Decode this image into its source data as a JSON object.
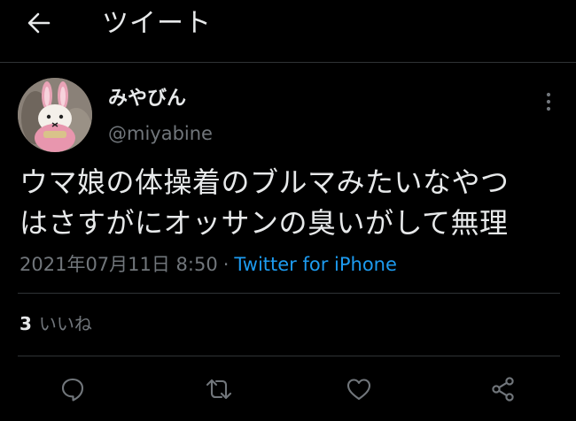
{
  "header": {
    "title": "ツイート",
    "back_icon": "arrow-left-icon"
  },
  "tweet": {
    "author": {
      "display_name": "みやびん",
      "handle": "@miyabine",
      "avatar_icon": "bunny-plush-avatar"
    },
    "text_line1": "ウマ娘の体操着のブルマみたいなやつ",
    "text_line2": "はさすがにオッサンの臭いがして無理",
    "timestamp": "2021年07月11日 8:50",
    "separator": "·",
    "source": "Twitter for iPhone",
    "likes": {
      "count": "3",
      "label": "いいね"
    }
  },
  "actions": [
    {
      "name": "reply",
      "icon": "reply-icon"
    },
    {
      "name": "retweet",
      "icon": "retweet-icon"
    },
    {
      "name": "like",
      "icon": "heart-icon"
    },
    {
      "name": "share",
      "icon": "share-icon"
    }
  ],
  "colors": {
    "background": "#000000",
    "text": "#e7e9ea",
    "muted": "#71767b",
    "link": "#1d9bf0",
    "divider": "#2f3336"
  }
}
